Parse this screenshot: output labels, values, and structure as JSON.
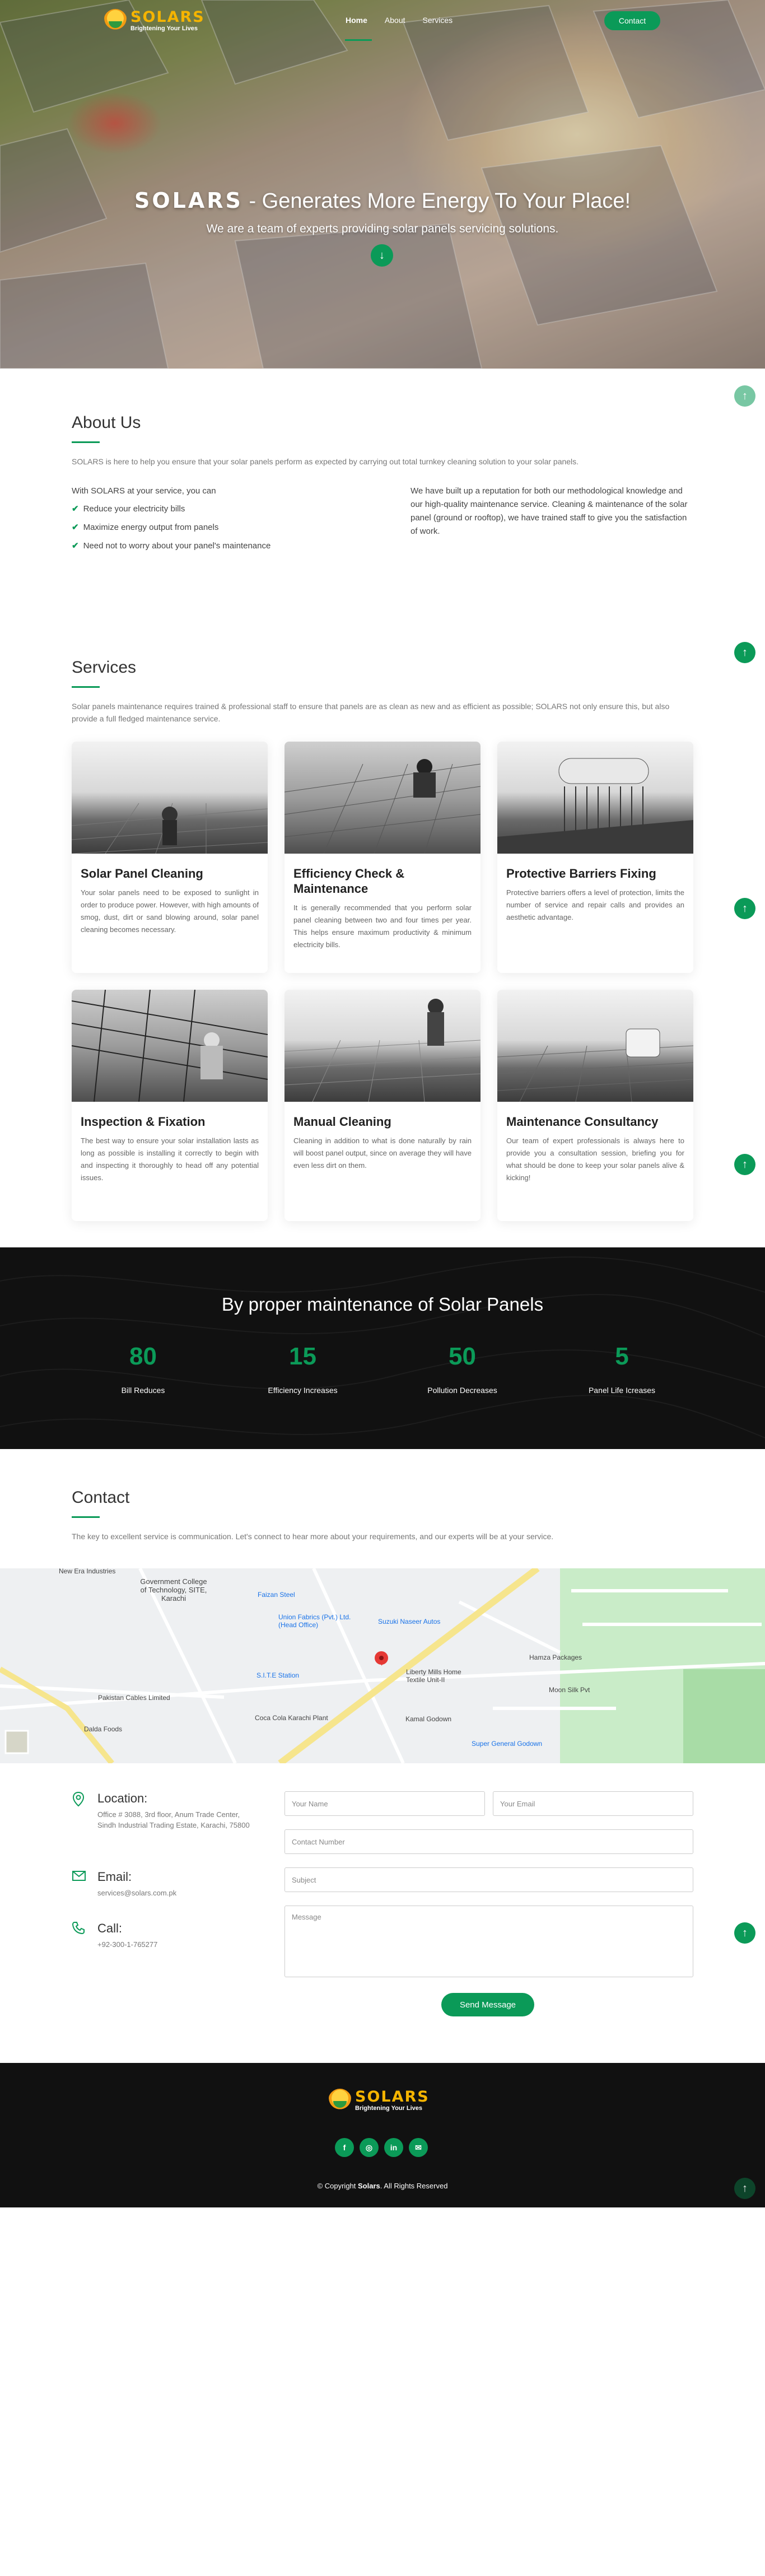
{
  "brand": {
    "name": "SOLARS",
    "tagline": "Brightening Your Lives"
  },
  "nav": {
    "links": [
      {
        "label": "Home"
      },
      {
        "label": "About"
      },
      {
        "label": "Services"
      }
    ],
    "cta": "Contact"
  },
  "hero": {
    "title_brand": "SOLARS",
    "title_rest": " - Generates More Energy To Your Place!",
    "subtitle": "We are a team of experts providing solar panels servicing solutions."
  },
  "about": {
    "title": "About Us",
    "lead": "SOLARS is here to help you ensure that your solar panels perform as expected by carrying out total turnkey cleaning solution to your solar panels.",
    "intro": "With SOLARS at your service, you can",
    "bullets": [
      "Reduce your electricity bills",
      "Maximize energy output from panels",
      "Need not to worry about your panel's maintenance"
    ],
    "paragraph": "We have built up a reputation for both our methodological knowledge and our high-quality maintenance service. Cleaning & maintenance of the solar panel (ground or rooftop), we have trained staff to give you the satisfaction of work."
  },
  "services": {
    "title": "Services",
    "lead": "Solar panels maintenance requires trained & professional staff to ensure that panels are as clean as new and as efficient as possible; SOLARS not only ensure this, but also provide a full fledged maintenance service.",
    "items": [
      {
        "title": "Solar Panel Cleaning",
        "text": "Your solar panels need to be exposed to sunlight in order to produce power. However, with high amounts of smog, dust, dirt or sand blowing around, solar panel cleaning becomes necessary."
      },
      {
        "title": "Efficiency Check & Maintenance",
        "text": "It is generally recommended that you perform solar panel cleaning between two and four times per year. This helps ensure maximum productivity & minimum electricity bills."
      },
      {
        "title": "Protective Barriers Fixing",
        "text": "Protective barriers offers a level of protection, limits the number of service and repair calls and provides an aesthetic advantage."
      },
      {
        "title": "Inspection & Fixation",
        "text": "The best way to ensure your solar installation lasts as long as possible is installing it correctly to begin with and inspecting it thoroughly to head off any potential issues."
      },
      {
        "title": "Manual Cleaning",
        "text": "Cleaning in addition to what is done naturally by rain will boost panel output, since on average they will have even less dirt on them."
      },
      {
        "title": "Maintenance Consultancy",
        "text": "Our team of expert professionals is always here to provide you a consultation session, briefing you for what should be done to keep your solar panels alive & kicking!"
      }
    ]
  },
  "stats": {
    "title": "By proper maintenance of Solar Panels",
    "items": [
      {
        "value": "80",
        "label": "Bill Reduces"
      },
      {
        "value": "15",
        "label": "Efficiency Increases"
      },
      {
        "value": "50",
        "label": "Pollution Decreases"
      },
      {
        "value": "5",
        "label": "Panel Life Icreases"
      }
    ]
  },
  "contact": {
    "title": "Contact",
    "lead": "The key to excellent service is communication. Let's connect to hear more about your requirements, and our experts will be at your service.",
    "location_title": "Location:",
    "location_text": "Office # 3088, 3rd floor, Anum Trade Center, Sindh Industrial Trading Estate, Karachi, 75800",
    "email_title": "Email:",
    "email_text": "services@solars.com.pk",
    "call_title": "Call:",
    "call_text": "+92-300-1-765277",
    "form": {
      "name_placeholder": "Your Name",
      "email_placeholder": "Your Email",
      "phone_placeholder": "Contact Number",
      "subject_placeholder": "Subject",
      "message_placeholder": "Message",
      "submit": "Send Message"
    }
  },
  "map": {
    "labels": [
      "New Era Industries",
      "Government College of Technology, SITE, Karachi",
      "Faizan Steel",
      "Union Fabrics (Pvt.) Ltd. (Head Office)",
      "Suzuki Naseer Autos",
      "S.I.T.E Station",
      "Liberty Mills Home Textile Unit-II",
      "Hamza Packages",
      "Moon Silk Pvt",
      "Pakistan Cables Limited",
      "Coca Cola Karachi Plant",
      "Kamal Godown",
      "Super General Godown",
      "Dalda Foods"
    ]
  },
  "footer": {
    "copyright_prefix": "© Copyright ",
    "copyright_brand": "Solars",
    "copyright_suffix": ". All Rights Reserved"
  },
  "colors": {
    "accent": "#0b9a58",
    "dark": "#111111",
    "logo_gold": "#f5b400"
  }
}
